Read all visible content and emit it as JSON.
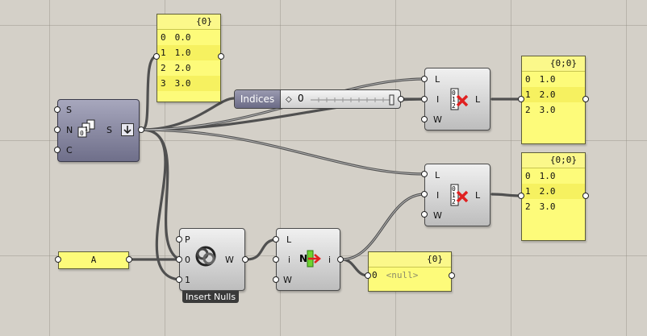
{
  "panels": {
    "top": {
      "header": "{0}",
      "rows": [
        {
          "i": "0",
          "v": "0.0"
        },
        {
          "i": "1",
          "v": "1.0"
        },
        {
          "i": "2",
          "v": "2.0"
        },
        {
          "i": "3",
          "v": "3.0"
        }
      ]
    },
    "right_top": {
      "header": "{0;0}",
      "rows": [
        {
          "i": "0",
          "v": "1.0"
        },
        {
          "i": "1",
          "v": "2.0"
        },
        {
          "i": "2",
          "v": "3.0"
        }
      ]
    },
    "right_mid": {
      "header": "{0;0}",
      "rows": [
        {
          "i": "0",
          "v": "1.0"
        },
        {
          "i": "1",
          "v": "2.0"
        },
        {
          "i": "2",
          "v": "3.0"
        }
      ]
    },
    "null_panel": {
      "header": "{0}",
      "rows": [
        {
          "i": "0",
          "v": "<null>"
        }
      ]
    },
    "input_a": {
      "value": "A"
    }
  },
  "series": {
    "pins_in": [
      "S",
      "N",
      "C"
    ],
    "pin_out": "S"
  },
  "slider": {
    "label": "Indices",
    "value": "0"
  },
  "cull_top": {
    "pins_in": [
      "L",
      "I",
      "W"
    ],
    "pin_out": "L"
  },
  "cull_mid": {
    "pins_in": [
      "L",
      "I",
      "W"
    ],
    "pin_out": "L"
  },
  "weave": {
    "pins_in": [
      "P",
      "0",
      "1"
    ],
    "pin_out": "W",
    "label": "Insert Nulls"
  },
  "null_item": {
    "pins_in": [
      "L",
      "i",
      "W"
    ],
    "pin_out": "i",
    "icon_text": "N"
  },
  "icons": [
    "series-icon",
    "cull-index-icon",
    "weave-icon",
    "null-item-icon",
    "slider-diamond-icon"
  ],
  "colors": {
    "canvas": "#d4d0c8",
    "panel": "#fdfb7a",
    "wire": "#4a4a4a",
    "cross": "#e02020"
  }
}
